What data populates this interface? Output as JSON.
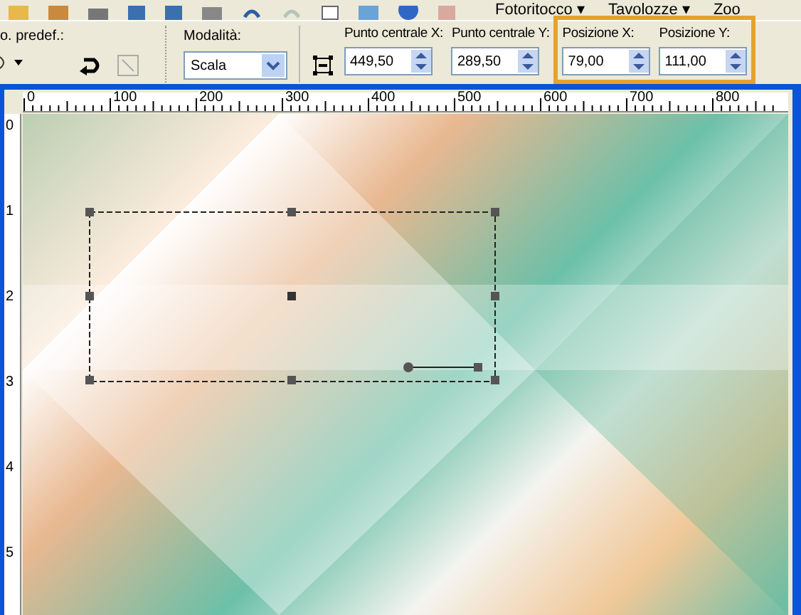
{
  "menu": [
    {
      "label": "Fotoritocco",
      "caret": "▾"
    },
    {
      "label": "Tavolozze",
      "caret": "▾"
    },
    {
      "label": "Zoo"
    }
  ],
  "options": {
    "preset_label": "o. predef.:",
    "mode": {
      "label": "Modalità:",
      "value": "Scala"
    },
    "fields": [
      {
        "label": "Punto centrale X:",
        "value": "449,50",
        "highlighted": false
      },
      {
        "label": "Punto centrale Y:",
        "value": "289,50",
        "highlighted": false
      },
      {
        "label": "Posizione X:",
        "value": "79,00",
        "highlighted": true
      },
      {
        "label": "Posizione Y:",
        "value": "111,00",
        "highlighted": true
      }
    ]
  },
  "ruler_h": [
    "0",
    "100",
    "200",
    "300",
    "400",
    "500",
    "600",
    "700",
    "800"
  ],
  "ruler_v": [
    "0",
    "1",
    "2",
    "3",
    "4",
    "5"
  ]
}
